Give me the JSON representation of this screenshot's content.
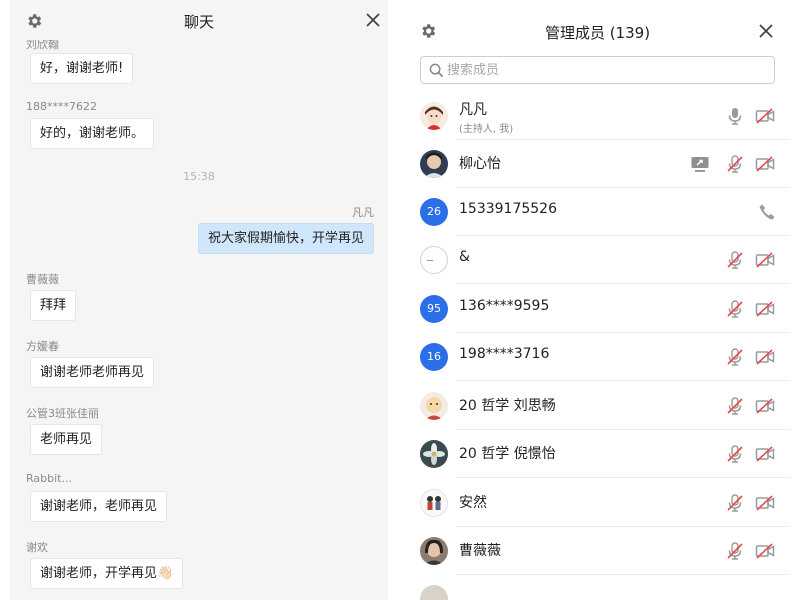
{
  "chat": {
    "title": "聊天",
    "messages": [
      {
        "sender": "刘欣翰",
        "text": "好，谢谢老师!"
      },
      {
        "sender": "188****7622",
        "text": "好的，谢谢老师。"
      },
      {
        "sender": "凡凡",
        "text": "祝大家假期愉快，开学再见",
        "self": true
      },
      {
        "sender": "曹薇薇",
        "text": "拜拜"
      },
      {
        "sender": "方媛春",
        "text": "谢谢老师老师再见"
      },
      {
        "sender": "公管3班张佳丽",
        "text": "老师再见"
      },
      {
        "sender": "Rabbit...",
        "text": "谢谢老师，老师再见"
      },
      {
        "sender": "谢欢",
        "text": "谢谢老师，开学再见👋🏻"
      }
    ],
    "timestamp": "15:38"
  },
  "members": {
    "title": "管理成员 (139)",
    "search_placeholder": "搜索成员",
    "list": [
      {
        "name": "凡凡",
        "sub": "(主持人, 我)",
        "avatar": "cartoon-avatar",
        "mic": "on",
        "cam": "off"
      },
      {
        "name": "柳心怡",
        "avatar": "photo-avatar",
        "screen_share": true,
        "mic": "off",
        "cam": "off"
      },
      {
        "name": "15339175526",
        "avatar_badge": "26",
        "phone": true
      },
      {
        "name": "&",
        "avatar": "blank-avatar",
        "mic": "off",
        "cam": "off"
      },
      {
        "name": "136****9595",
        "avatar_badge": "95",
        "mic": "off",
        "cam": "off"
      },
      {
        "name": "198****3716",
        "avatar_badge": "16",
        "mic": "off",
        "cam": "off"
      },
      {
        "name": "20 哲学 刘思畅",
        "avatar": "cartoon-avatar",
        "mic": "off",
        "cam": "off"
      },
      {
        "name": "20 哲学 倪憬怡",
        "avatar": "flower-avatar",
        "mic": "off",
        "cam": "off"
      },
      {
        "name": "安然",
        "avatar": "drawing-avatar",
        "mic": "off",
        "cam": "off"
      },
      {
        "name": "曹薇薇",
        "avatar": "photo-avatar",
        "mic": "off",
        "cam": "off"
      }
    ]
  },
  "colors": {
    "accent_blue": "#2a6ee8",
    "muted_red": "#e5484d",
    "icon_gray": "#9a9a9a",
    "self_bubble": "#cfe6fb",
    "chat_bg": "#f5f5f5"
  },
  "icons": [
    "gear-icon",
    "close-icon",
    "search-icon",
    "mic-icon",
    "mic-muted-icon",
    "camera-off-icon",
    "screen-share-icon",
    "phone-icon"
  ]
}
